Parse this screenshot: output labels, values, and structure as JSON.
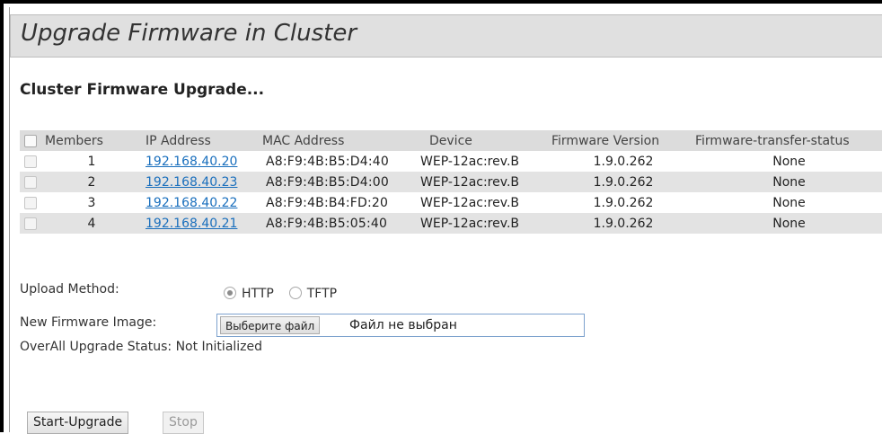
{
  "page_title": "Upgrade Firmware in Cluster",
  "section_title": "Cluster Firmware Upgrade...",
  "table": {
    "headers": [
      "Members",
      "IP Address",
      "MAC Address",
      "Device",
      "Firmware Version",
      "Firmware-transfer-status"
    ],
    "rows": [
      {
        "member": "1",
        "ip": "192.168.40.20",
        "mac": "A8:F9:4B:B5:D4:40",
        "device": "WEP-12ac:rev.B",
        "firmware": "1.9.0.262",
        "status": "None"
      },
      {
        "member": "2",
        "ip": "192.168.40.23",
        "mac": "A8:F9:4B:B5:D4:00",
        "device": "WEP-12ac:rev.B",
        "firmware": "1.9.0.262",
        "status": "None"
      },
      {
        "member": "3",
        "ip": "192.168.40.22",
        "mac": "A8:F9:4B:B4:FD:20",
        "device": "WEP-12ac:rev.B",
        "firmware": "1.9.0.262",
        "status": "None"
      },
      {
        "member": "4",
        "ip": "192.168.40.21",
        "mac": "A8:F9:4B:B5:05:40",
        "device": "WEP-12ac:rev.B",
        "firmware": "1.9.0.262",
        "status": "None"
      }
    ]
  },
  "upload_method": {
    "label": "Upload Method:",
    "options": [
      "HTTP",
      "TFTP"
    ],
    "selected": "HTTP"
  },
  "firmware_image": {
    "label": "New Firmware Image:",
    "button_label": "Выберите файл",
    "file_name": "Файл не выбран"
  },
  "overall_status": "OverAll Upgrade Status: Not Initialized",
  "buttons": {
    "start": "Start-Upgrade",
    "stop": "Stop"
  },
  "colors": {
    "link": "#1a6fbd",
    "header_bg": "#dcdcdc",
    "alt_row_bg": "#e3e3e3",
    "title_bar_bg": "#e0e0e0"
  }
}
